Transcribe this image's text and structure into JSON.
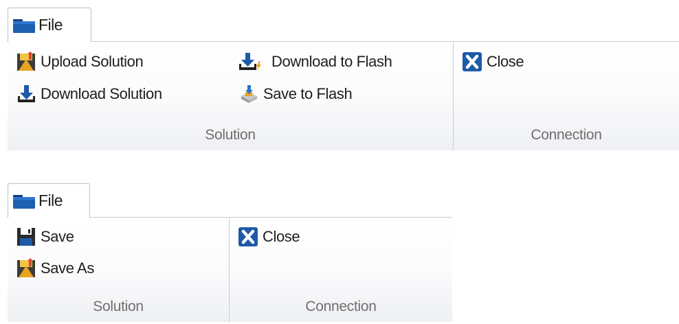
{
  "ribbon_top": {
    "tab": {
      "label": "File"
    },
    "groups": {
      "solution": {
        "label": "Solution",
        "upload_solution": "Upload Solution",
        "download_solution": "Download Solution",
        "download_to_flash": "Download to Flash",
        "save_to_flash": "Save to Flash"
      },
      "connection": {
        "label": "Connection",
        "close": "Close"
      }
    }
  },
  "ribbon_bottom": {
    "tab": {
      "label": "File"
    },
    "groups": {
      "solution": {
        "label": "Solution",
        "save": "Save",
        "save_as": "Save As"
      },
      "connection": {
        "label": "Connection",
        "close": "Close"
      }
    }
  },
  "icons": {
    "folder": "folder-icon",
    "upload": "upload-solution-icon",
    "download": "download-icon",
    "download_flash": "download-to-flash-icon",
    "save_flash": "save-to-flash-icon",
    "close": "close-icon",
    "save": "floppy-disk-icon",
    "save_as": "save-as-icon"
  },
  "colors": {
    "accent_blue": "#1c4f9c",
    "close_blue": "#1d5aa8",
    "folder_blue": "#1f5fb0"
  }
}
